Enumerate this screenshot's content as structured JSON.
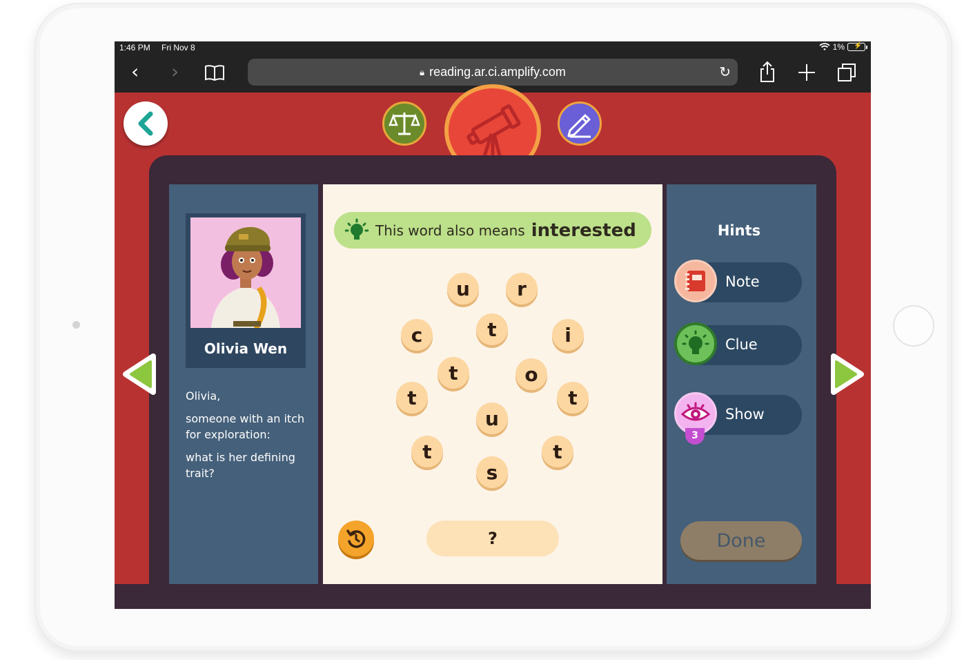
{
  "status_bar": {
    "time": "1:46 PM",
    "date": "Fri Nov 8",
    "battery": "1%"
  },
  "browser": {
    "url": "reading.ar.ci.amplify.com"
  },
  "character": {
    "name": "Olivia Wen",
    "clue_lines": [
      "Olivia,",
      "someone with an itch for exploration:",
      "what is her defining trait?"
    ]
  },
  "hint_banner": {
    "prefix": "This word also means",
    "word": "interested"
  },
  "letter_tiles": [
    "u",
    "r",
    "c",
    "t",
    "i",
    "t",
    "o",
    "t",
    "t",
    "u",
    "t",
    "t",
    "s"
  ],
  "answer": {
    "placeholder": "?"
  },
  "hints": {
    "title": "Hints",
    "items": [
      {
        "label": "Note",
        "icon": "notebook-icon"
      },
      {
        "label": "Clue",
        "icon": "lightbulb-icon"
      },
      {
        "label": "Show",
        "icon": "eye-icon",
        "badge": "3"
      }
    ],
    "done_label": "Done"
  },
  "colors": {
    "background_red": "#b83232",
    "board": "#3b2838",
    "panel": "#45607a",
    "tile": "#fcd7a2",
    "hint_green": "#bde08a",
    "done_disabled": "#8f7e67"
  }
}
